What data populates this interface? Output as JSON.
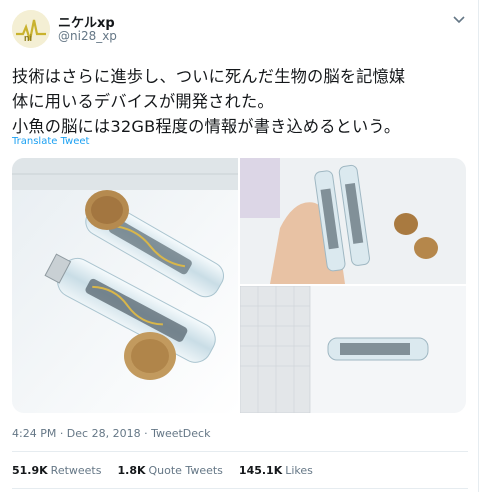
{
  "tweet": {
    "display_name": "ニケルxp",
    "handle": "@ni28_xp",
    "text_lines": [
      "技術はさらに進歩し、ついに死んだ生物の脳を記憶媒",
      "体に用いるデバイスが開発された。",
      "小魚の脳には32GB程度の情報が書き込めるという。"
    ],
    "translate_label": "Translate Tweet",
    "timestamp": "4:24 PM · Dec 28, 2018 · TweetDeck"
  },
  "stats": [
    {
      "value": "51.9K",
      "label": "Retweets"
    },
    {
      "value": "1.8K",
      "label": "Quote Tweets"
    },
    {
      "value": "145.1K",
      "label": "Likes"
    }
  ],
  "icons": {
    "avatar": "ni-logo-icon",
    "more": "chevron-down-icon"
  },
  "colors": {
    "link": "#1da1f2",
    "secondary": "#657786",
    "border": "#e6ecf0"
  }
}
